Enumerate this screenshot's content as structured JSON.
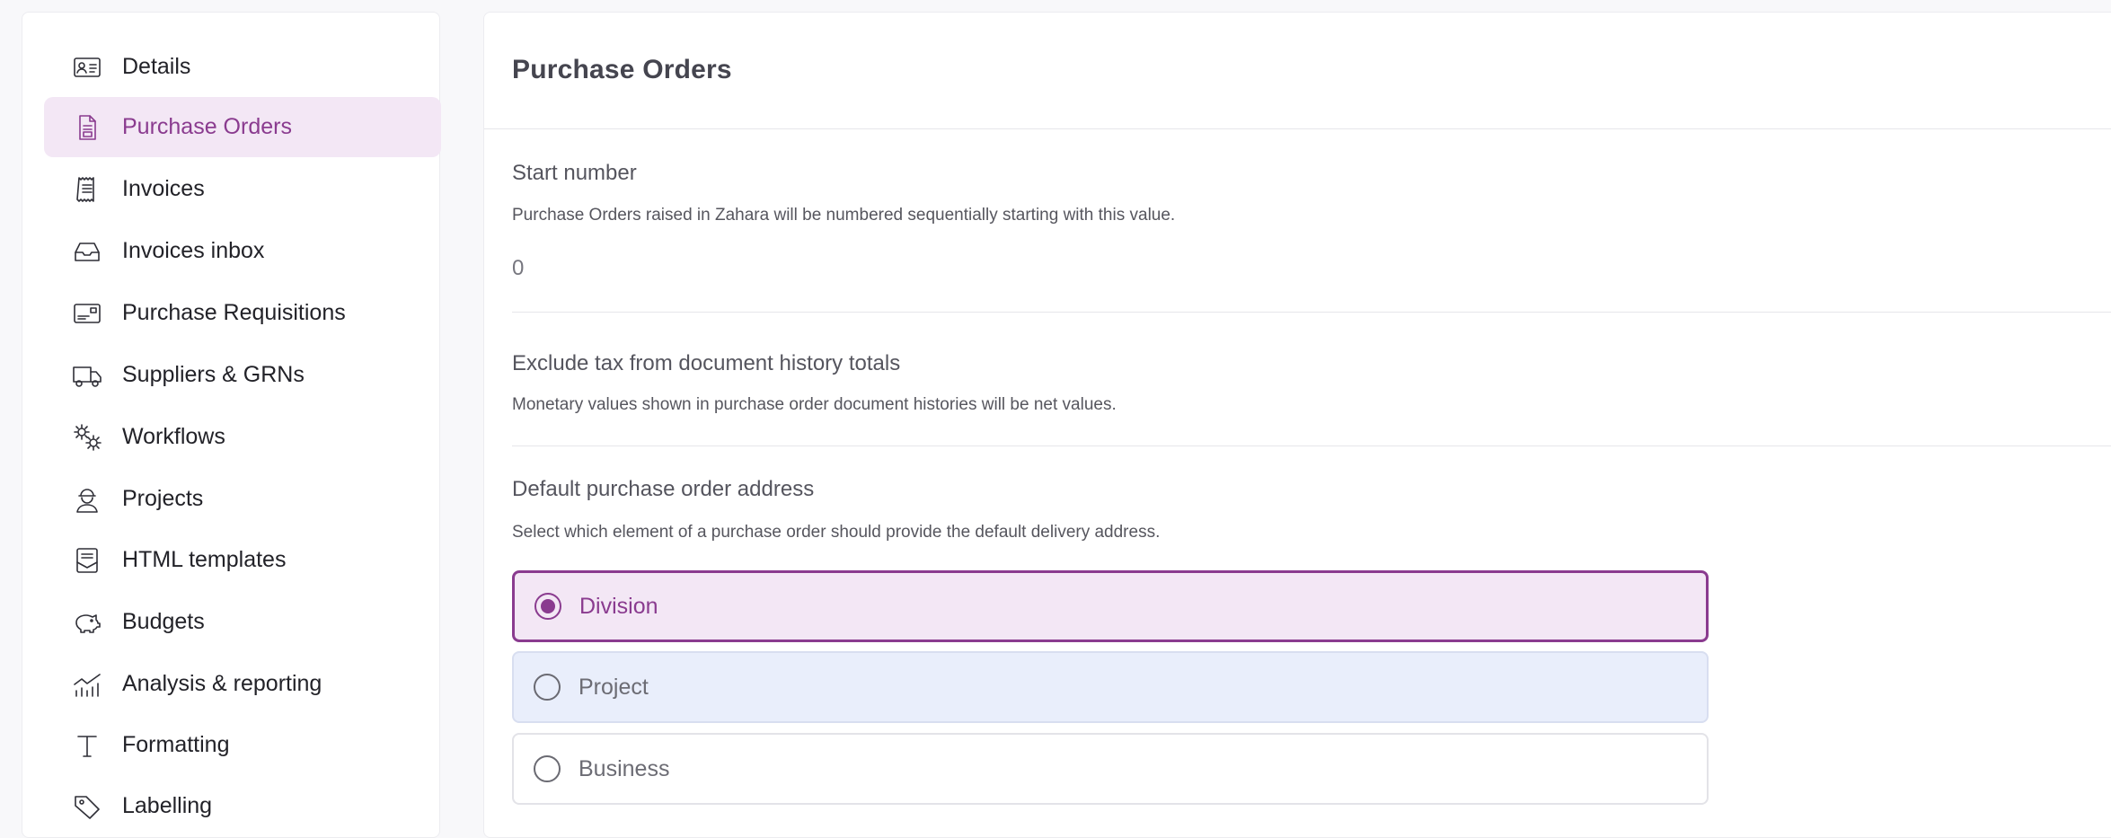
{
  "sidebar": {
    "items": [
      {
        "label": "Details",
        "icon": "id-card-icon"
      },
      {
        "label": "Purchase Orders",
        "icon": "document-icon",
        "active": true
      },
      {
        "label": "Invoices",
        "icon": "receipt-icon"
      },
      {
        "label": "Invoices inbox",
        "icon": "inbox-icon"
      },
      {
        "label": "Purchase Requisitions",
        "icon": "requisition-card-icon"
      },
      {
        "label": "Suppliers & GRNs",
        "icon": "truck-icon"
      },
      {
        "label": "Workflows",
        "icon": "gears-icon"
      },
      {
        "label": "Projects",
        "icon": "worker-icon"
      },
      {
        "label": "HTML templates",
        "icon": "template-icon"
      },
      {
        "label": "Budgets",
        "icon": "piggy-bank-icon"
      },
      {
        "label": "Analysis & reporting",
        "icon": "chart-icon"
      },
      {
        "label": "Formatting",
        "icon": "text-format-icon"
      },
      {
        "label": "Labelling",
        "icon": "tag-icon"
      }
    ]
  },
  "main": {
    "title": "Purchase Orders",
    "start_number": {
      "title": "Start number",
      "description": "Purchase Orders raised in Zahara will be numbered sequentially starting with this value.",
      "value": "0"
    },
    "exclude_tax": {
      "title": "Exclude tax from document history totals",
      "description": "Monetary values shown in purchase order document histories will be net values."
    },
    "default_address": {
      "title": "Default purchase order address",
      "description": "Select which element of a purchase order should provide the default delivery address.",
      "options": [
        {
          "label": "Division",
          "selected": true
        },
        {
          "label": "Project",
          "selected": false
        },
        {
          "label": "Business",
          "selected": false
        }
      ]
    }
  },
  "colors": {
    "accent": "#8a3b8f",
    "active_bg": "#f3e7f5",
    "hover_bg": "#e9eefb"
  }
}
